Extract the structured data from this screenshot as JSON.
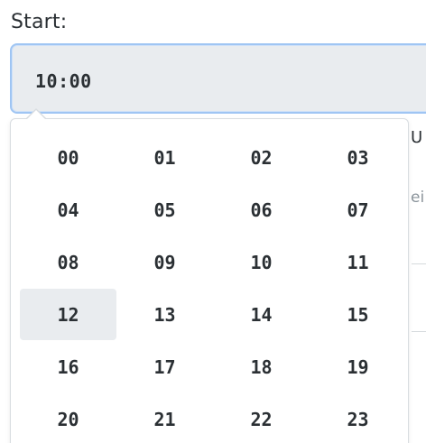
{
  "start": {
    "label": "Start:",
    "value": "10:00"
  },
  "background": {
    "char1": "U",
    "char2": "ei"
  },
  "picker": {
    "selected": "12",
    "hours": [
      "00",
      "01",
      "02",
      "03",
      "04",
      "05",
      "06",
      "07",
      "08",
      "09",
      "10",
      "11",
      "12",
      "13",
      "14",
      "15",
      "16",
      "17",
      "18",
      "19",
      "20",
      "21",
      "22",
      "23"
    ]
  },
  "colors": {
    "input_bg": "#e9ecef",
    "input_border": "#9fc5f3",
    "selected_bg": "#e9ecef",
    "text": "#2b3034"
  }
}
